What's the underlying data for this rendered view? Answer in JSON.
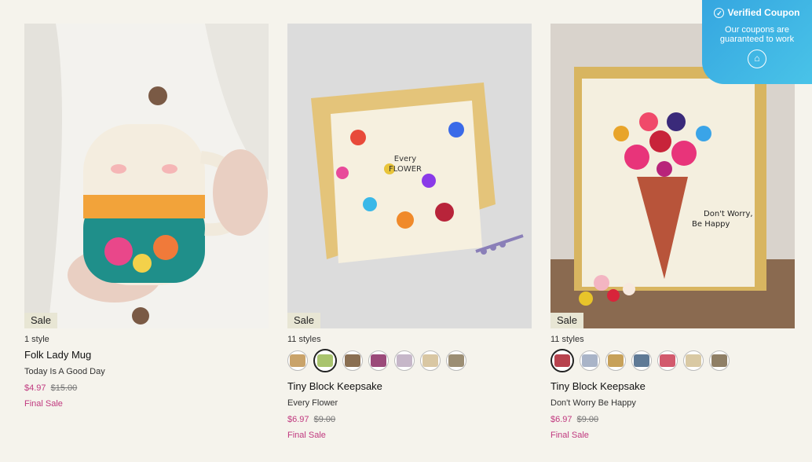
{
  "coupon": {
    "title": "Verified Coupon",
    "line1": "Our coupons are",
    "line2": "guaranteed to work"
  },
  "products": [
    {
      "image": "folk-lady-mug-photo",
      "sale_label": "Sale",
      "styles": "1 style",
      "title": "Folk Lady Mug",
      "variant": "Today Is A Good Day",
      "price": "$4.97",
      "was_price": "$15.00",
      "final": "Final Sale",
      "swatches": []
    },
    {
      "image": "every-flower-block-photo",
      "sale_label": "Sale",
      "styles": "11 styles",
      "title": "Tiny Block Keepsake",
      "variant": "Every Flower",
      "price": "$6.97",
      "was_price": "$9.00",
      "final": "Final Sale",
      "selected_swatch": 1,
      "swatches": [
        "#c9a36a",
        "#a9c46e",
        "#8a6f52",
        "#9b4a7a",
        "#c6b7c9",
        "#d9c7a3",
        "#9c8e74"
      ]
    },
    {
      "image": "dont-worry-be-happy-block-photo",
      "sale_label": "Sale",
      "styles": "11 styles",
      "title": "Tiny Block Keepsake",
      "variant": "Don't Worry Be Happy",
      "price": "$6.97",
      "was_price": "$9.00",
      "final": "Final Sale",
      "selected_swatch": 0,
      "swatches": [
        "#b8434f",
        "#a9b4c8",
        "#c7a15a",
        "#5f7a96",
        "#d25a6d",
        "#d9c9a4",
        "#8f7f66"
      ]
    }
  ]
}
